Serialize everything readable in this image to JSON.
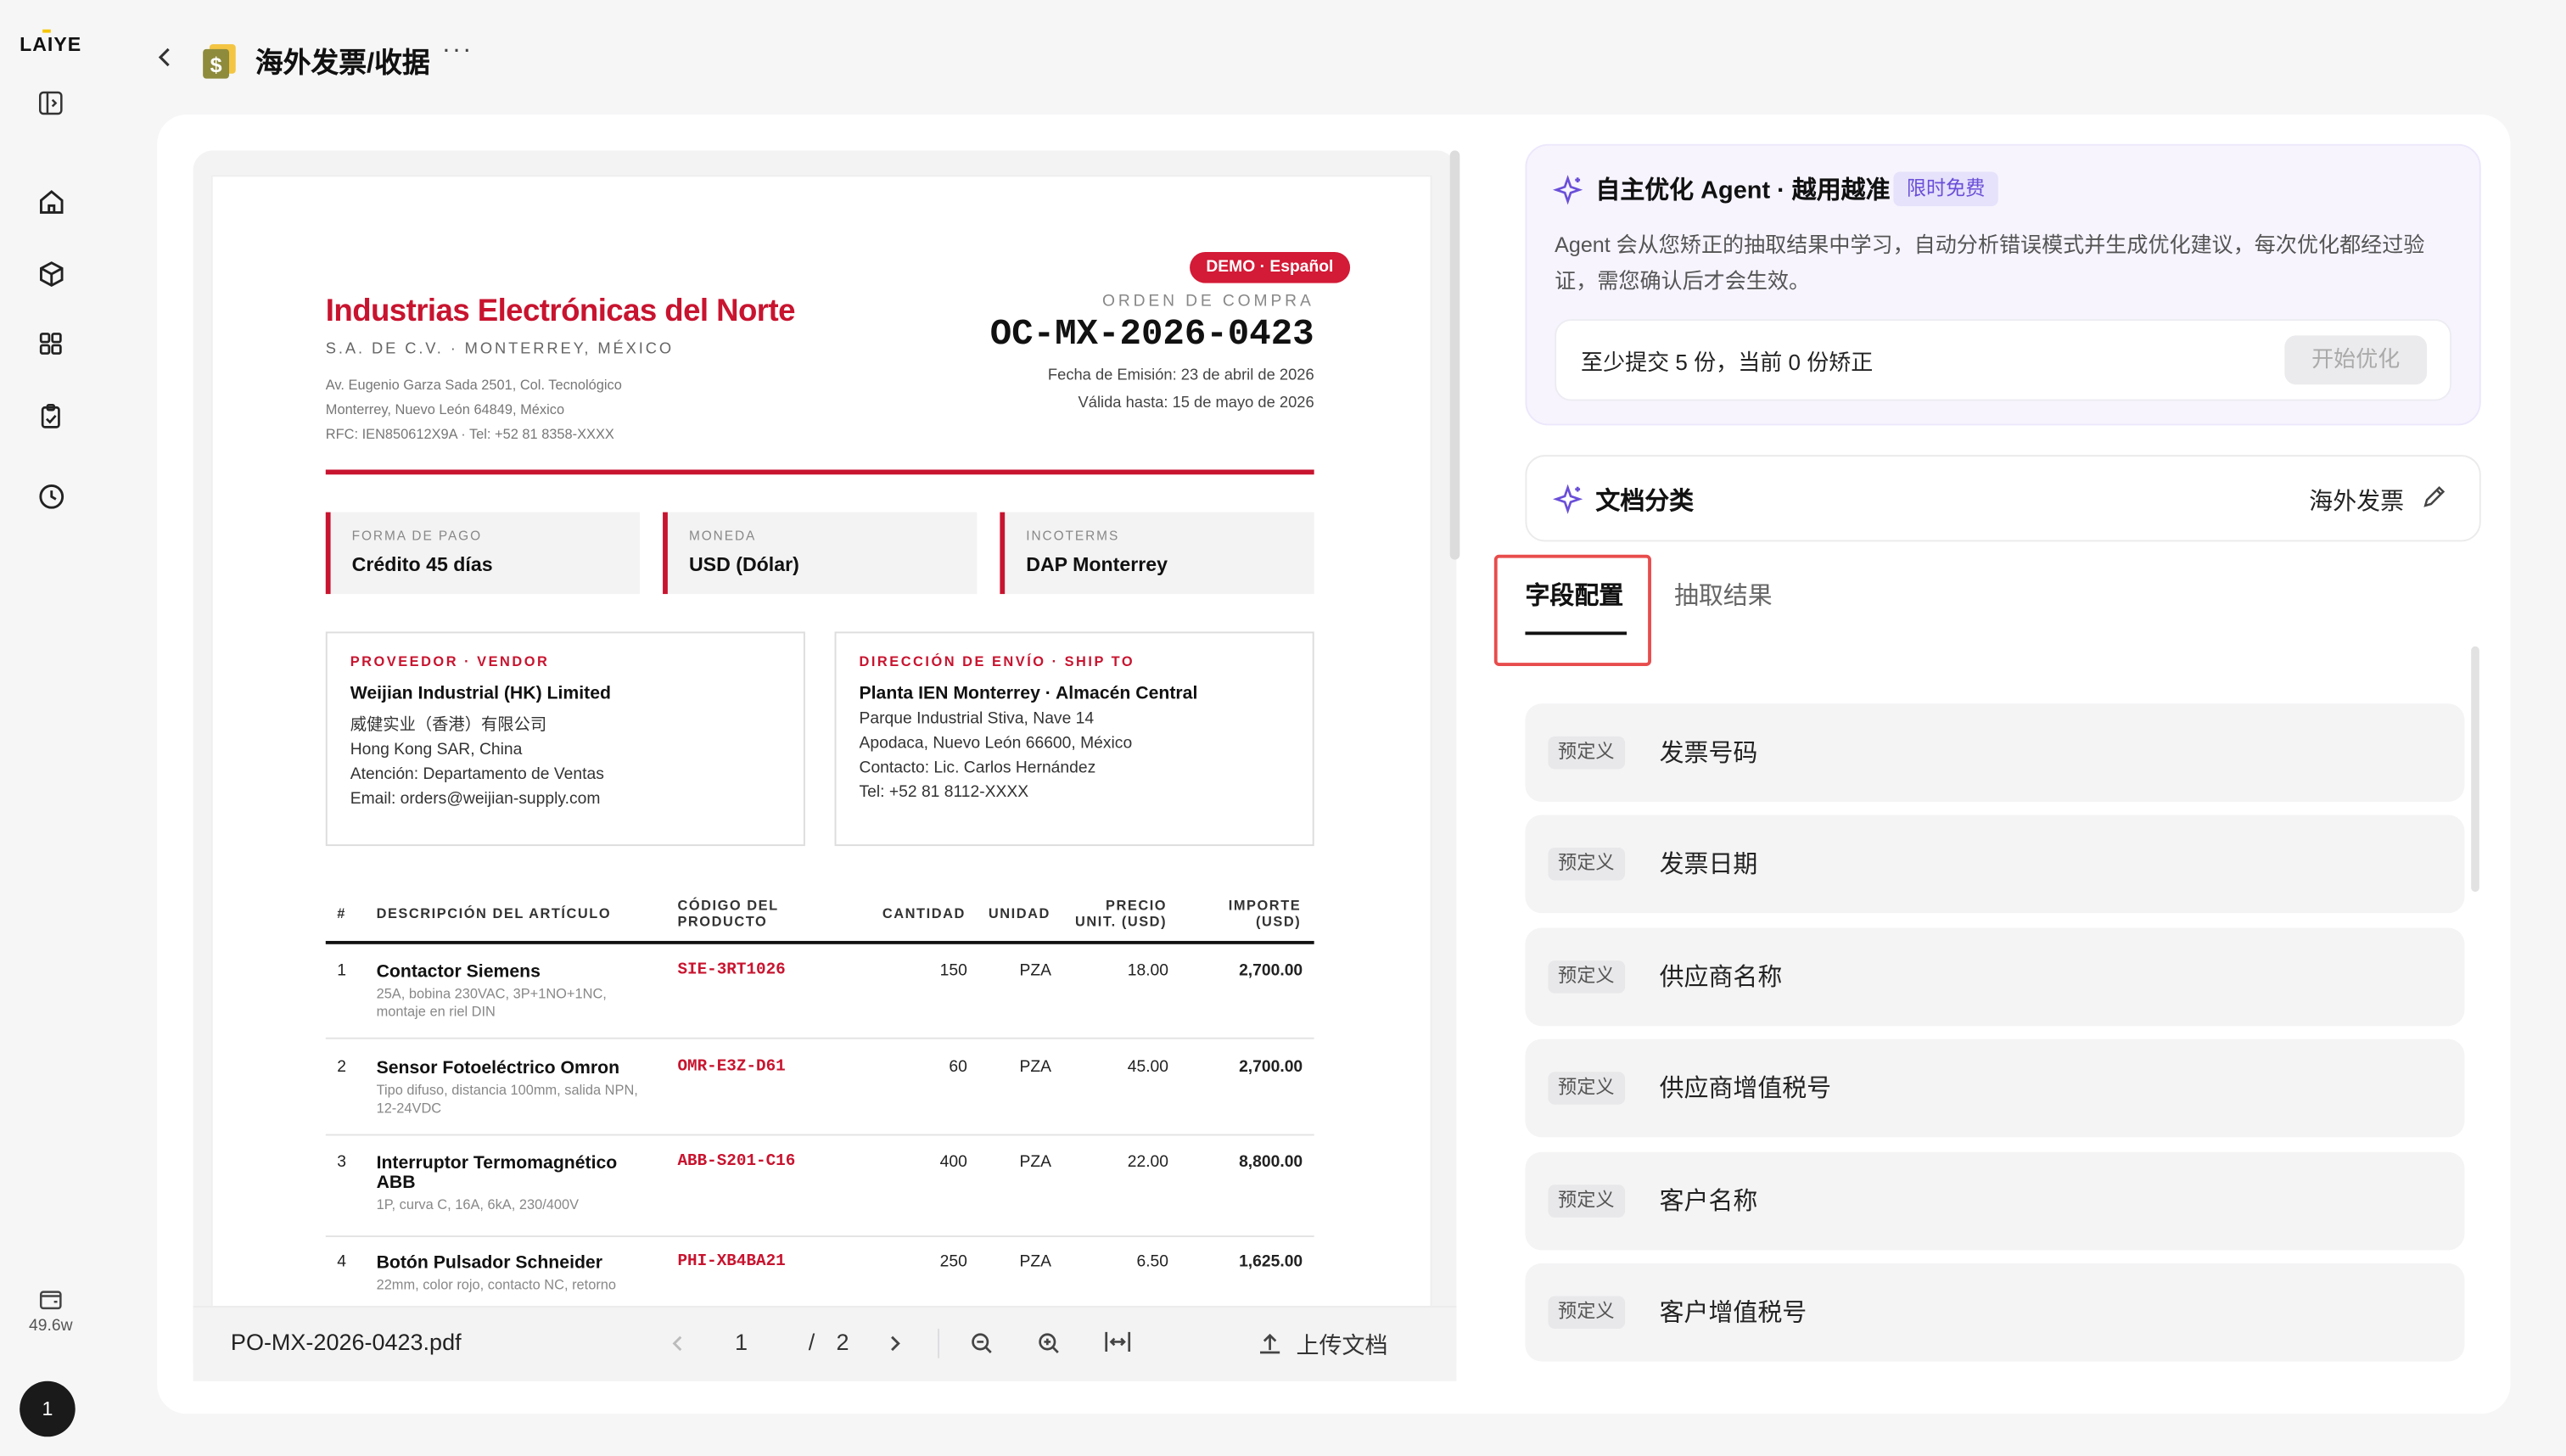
{
  "app": {
    "logo": "LAIYE"
  },
  "sidebar": {
    "items": [
      {
        "name": "home-icon"
      },
      {
        "name": "cube-icon"
      },
      {
        "name": "grid-icon"
      },
      {
        "name": "clipboard-icon"
      },
      {
        "name": "clock-icon"
      }
    ],
    "credits": "49.6w",
    "avatar_badge": "1"
  },
  "header": {
    "title": "海外发票/收据",
    "more": "···"
  },
  "invoice": {
    "demo_badge": "DEMO · Español",
    "company": "Industrias Electrónicas del Norte",
    "company_sub": "S.A. DE C.V. · MONTERREY, MÉXICO",
    "address": [
      "Av. Eugenio Garza Sada 2501, Col. Tecnológico",
      "Monterrey, Nuevo León 64849, México",
      "RFC: IEN850612X9A · Tel: +52 81 8358-XXXX"
    ],
    "order_label": "ORDEN DE COMPRA",
    "order_no": "OC-MX-2026-0423",
    "issue_date": "Fecha de Emisión: 23 de abril de 2026",
    "valid_until": "Válida hasta: 15 de mayo de 2026",
    "info_boxes": [
      {
        "label": "FORMA DE PAGO",
        "value": "Crédito 45 días"
      },
      {
        "label": "MONEDA",
        "value": "USD (Dólar)"
      },
      {
        "label": "INCOTERMS",
        "value": "DAP Monterrey"
      }
    ],
    "vendor": {
      "heading": "PROVEEDOR · VENDOR",
      "name": "Weijian Industrial (HK) Limited",
      "lines": [
        "威健实业（香港）有限公司",
        "Hong Kong SAR, China",
        "Atención: Departamento de Ventas",
        "Email: orders@weijian-supply.com"
      ]
    },
    "ship_to": {
      "heading": "DIRECCIÓN DE ENVÍO · SHIP TO",
      "name": "Planta IEN Monterrey · Almacén Central",
      "lines": [
        "Parque Industrial Stiva, Nave 14",
        "Apodaca, Nuevo León 66600, México",
        "Contacto: Lic. Carlos Hernández",
        "Tel: +52 81 8112-XXXX"
      ]
    },
    "table_headers": {
      "num": "#",
      "desc": "DESCRIPCIÓN DEL ARTÍCULO",
      "code_1": "CÓDIGO DEL",
      "code_2": "PRODUCTO",
      "qty": "CANTIDAD",
      "unit": "UNIDAD",
      "price_1": "PRECIO",
      "price_2": "UNIT. (USD)",
      "amount_1": "IMPORTE",
      "amount_2": "(USD)"
    },
    "rows": [
      {
        "n": "1",
        "title": "Contactor Siemens",
        "sub": "25A, bobina 230VAC, 3P+1NO+1NC, montaje en riel DIN",
        "code": "SIE-3RT1026",
        "qty": "150",
        "unit": "PZA",
        "price": "18.00",
        "amount": "2,700.00"
      },
      {
        "n": "2",
        "title": "Sensor Fotoeléctrico Omron",
        "sub": "Tipo difuso, distancia 100mm, salida NPN, 12-24VDC",
        "code": "OMR-E3Z-D61",
        "qty": "60",
        "unit": "PZA",
        "price": "45.00",
        "amount": "2,700.00"
      },
      {
        "n": "3",
        "title": "Interruptor Termomagnético ABB",
        "sub": "1P, curva C, 16A, 6kA, 230/400V",
        "code": "ABB-S201-C16",
        "qty": "400",
        "unit": "PZA",
        "price": "22.00",
        "amount": "8,800.00"
      },
      {
        "n": "4",
        "title": "Botón Pulsador Schneider",
        "sub": "22mm, color rojo, contacto NC, retorno",
        "code": "PHI-XB4BA21",
        "qty": "250",
        "unit": "PZA",
        "price": "6.50",
        "amount": "1,625.00"
      }
    ]
  },
  "viewer": {
    "file_name": "PO-MX-2026-0423.pdf",
    "page": "1",
    "page_sep": "/",
    "total_pages": "2",
    "upload_label": "上传文档"
  },
  "agent": {
    "title": "自主优化 Agent · 越用越准",
    "badge": "限时免费",
    "description": "Agent 会从您矫正的抽取结果中学习，自动分析错误模式并生成优化建议，每次优化都经过验证，需您确认后才会生效。",
    "tip": "至少提交 5 份，当前 0 份矫正",
    "button": "开始优化"
  },
  "classification": {
    "title": "文档分类",
    "value": "海外发票"
  },
  "tabs": [
    {
      "label": "字段配置",
      "active": true
    },
    {
      "label": "抽取结果",
      "active": false
    }
  ],
  "fields": [
    {
      "tag": "预定义",
      "label": "发票号码"
    },
    {
      "tag": "预定义",
      "label": "发票日期"
    },
    {
      "tag": "预定义",
      "label": "供应商名称"
    },
    {
      "tag": "预定义",
      "label": "供应商增值税号"
    },
    {
      "tag": "预定义",
      "label": "客户名称"
    },
    {
      "tag": "预定义",
      "label": "客户增值税号"
    }
  ],
  "colors": {
    "accent_red": "#c8142f",
    "agent_purple": "#6a4fd8",
    "highlight_border": "#e84c4c"
  }
}
